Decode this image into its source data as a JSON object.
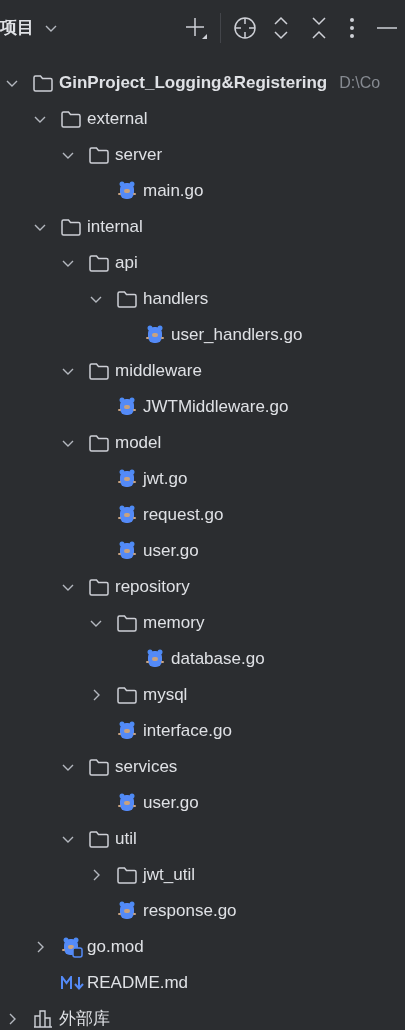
{
  "header": {
    "title": "项目"
  },
  "tree": [
    {
      "kind": "project",
      "label": "GinProject_Logging&Registering",
      "path": "D:\\Co",
      "expanded": true,
      "children": [
        {
          "kind": "folder",
          "label": "external",
          "expanded": true,
          "children": [
            {
              "kind": "folder",
              "label": "server",
              "expanded": true,
              "children": [
                {
                  "kind": "gofile",
                  "label": "main.go"
                }
              ]
            }
          ]
        },
        {
          "kind": "folder",
          "label": "internal",
          "expanded": true,
          "children": [
            {
              "kind": "folder",
              "label": "api",
              "expanded": true,
              "children": [
                {
                  "kind": "folder",
                  "label": "handlers",
                  "expanded": true,
                  "children": [
                    {
                      "kind": "gofile",
                      "label": "user_handlers.go"
                    }
                  ]
                }
              ]
            },
            {
              "kind": "folder",
              "label": "middleware",
              "expanded": true,
              "children": [
                {
                  "kind": "gofile",
                  "label": "JWTMiddleware.go"
                }
              ]
            },
            {
              "kind": "folder",
              "label": "model",
              "expanded": true,
              "children": [
                {
                  "kind": "gofile",
                  "label": "jwt.go"
                },
                {
                  "kind": "gofile",
                  "label": "request.go"
                },
                {
                  "kind": "gofile",
                  "label": "user.go"
                }
              ]
            },
            {
              "kind": "folder",
              "label": "repository",
              "expanded": true,
              "children": [
                {
                  "kind": "folder",
                  "label": "memory",
                  "expanded": true,
                  "children": [
                    {
                      "kind": "gofile",
                      "label": "database.go"
                    }
                  ]
                },
                {
                  "kind": "folder",
                  "label": "mysql",
                  "expanded": false
                },
                {
                  "kind": "gofile",
                  "label": "interface.go"
                }
              ]
            },
            {
              "kind": "folder",
              "label": "services",
              "expanded": true,
              "children": [
                {
                  "kind": "gofile",
                  "label": "user.go"
                }
              ]
            },
            {
              "kind": "folder",
              "label": "util",
              "expanded": true,
              "children": [
                {
                  "kind": "folder",
                  "label": "jwt_util",
                  "expanded": false
                },
                {
                  "kind": "gofile",
                  "label": "response.go"
                }
              ]
            }
          ]
        },
        {
          "kind": "gomod",
          "label": "go.mod",
          "expanded": false
        },
        {
          "kind": "markdown",
          "label": "README.md"
        }
      ]
    },
    {
      "kind": "library",
      "label": "外部库",
      "expanded": false
    }
  ]
}
